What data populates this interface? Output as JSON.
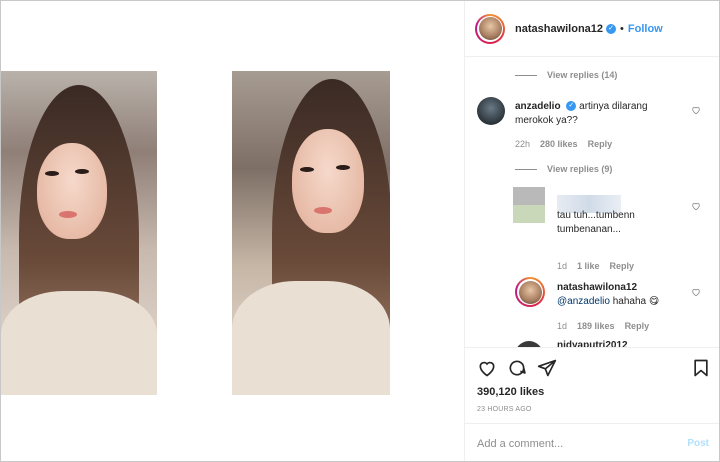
{
  "header": {
    "username": "natashawilona12",
    "verified_glyph": "✓",
    "separator": "•",
    "follow_label": "Follow"
  },
  "comments": {
    "view_replies_1": "View replies (14)",
    "comment_1": {
      "username": "anzadelio",
      "text": "artinya dilarang merokok ya??",
      "time": "22h",
      "likes": "280 likes",
      "reply": "Reply"
    },
    "view_replies_2": "View replies (9)",
    "reply_1": {
      "text": "tau tuh...tumbenn tumbenanan...",
      "time": "1d",
      "likes": "1 like",
      "reply": "Reply"
    },
    "reply_2": {
      "username": "natashawilona12",
      "mention": "@anzadelio",
      "text": "hahaha 😋",
      "time": "1d",
      "likes": "189 likes",
      "reply": "Reply"
    },
    "partial_next": "nidyaputri2012"
  },
  "actions": {
    "icons": [
      "heart-icon",
      "comment-icon",
      "share-icon",
      "bookmark-icon"
    ],
    "likes": "390,120 likes",
    "post_time": "23 HOURS AGO"
  },
  "add_comment": {
    "placeholder": "Add a comment...",
    "post_label": "Post"
  },
  "colors": {
    "accent": "#3897f0",
    "muted": "#8e8e8e",
    "post_disabled": "#b2dffc"
  }
}
